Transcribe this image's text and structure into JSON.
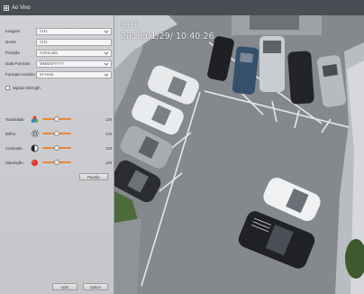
{
  "window": {
    "title": "Ao Vivo"
  },
  "panel": {
    "fields": [
      {
        "label": "Imagem",
        "value": "CH1",
        "has_dropdown": true
      },
      {
        "label": "Nome",
        "value": "CH1",
        "has_dropdown": false
      },
      {
        "label": "Posição",
        "value": "Acima alto",
        "has_dropdown": true
      },
      {
        "label": "Data Formato",
        "value": "MM/DD/YYYY",
        "has_dropdown": true
      },
      {
        "label": "Formato Horário",
        "value": "24 Hora",
        "has_dropdown": true
      }
    ],
    "signal_strength_label": "Signal Strength",
    "sliders": [
      {
        "label": "Tonalidade",
        "value": 128,
        "icon": "color-wheel-icon",
        "fraction": 0.5
      },
      {
        "label": "Brilho",
        "value": 128,
        "icon": "sun-icon",
        "fraction": 0.5
      },
      {
        "label": "Contraste",
        "value": 128,
        "icon": "contrast-icon",
        "fraction": 0.5
      },
      {
        "label": "Saturação",
        "value": 128,
        "icon": "saturation-icon",
        "fraction": 0.5
      }
    ],
    "default_button": "Padrão",
    "apply_button": "Aplic",
    "save_button": "Salvar"
  },
  "video": {
    "channel_label": "CH1",
    "datetime": "2018/01/29/  10:40:26"
  },
  "colors": {
    "titlebar": "#4a4d53",
    "panel": "#cfd1d4",
    "slider_track": "#e8883a",
    "saturation": "#e0332b"
  }
}
